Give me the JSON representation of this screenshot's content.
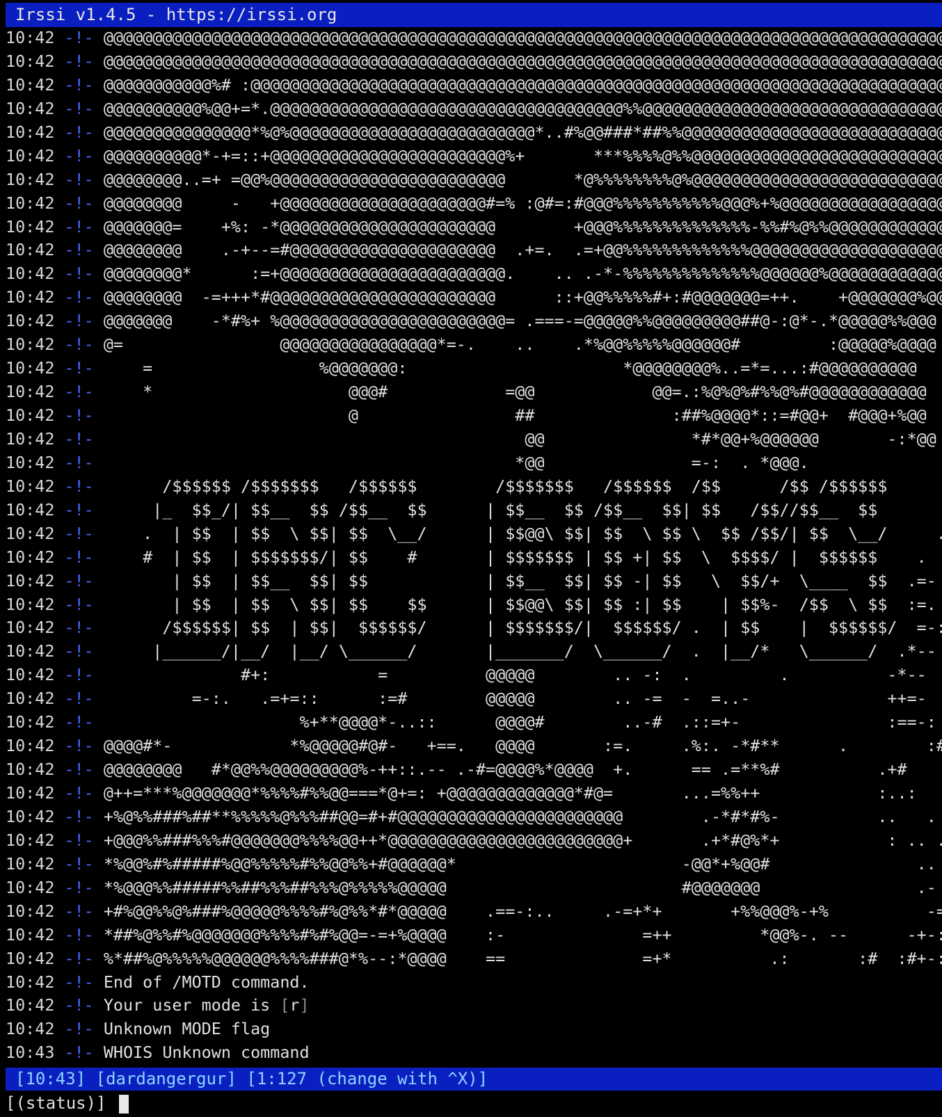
{
  "window": {
    "title": "Irssi v1.4.5 - https://irssi.org"
  },
  "colors": {
    "background": "#000000",
    "bar": "#0a1fc0",
    "separator": "#4a67ff",
    "bar_text": "#8fd4ff"
  },
  "messages": [
    {
      "time": "10:42",
      "text": "@@@@@@@@@@@@@@@@@@@@@@@@@@@@@@@@@@@@@@@@@@@@@@@@@@@@@@@@@@@@@@@@@@@@@@@@@@@@@@@@@@@@@@@@@@@@@@@@@@@@@"
    },
    {
      "time": "10:42",
      "text": "@@@@@@@@@@@@@@@@@@@@@@@@@@@@@@@@@@@@@@@@@@@@@@@@@@@@@@@@@@@@@@@@@@@@@@@@@@@@@@@@@@@@@@@@@@@@@@@@@@@@@"
    },
    {
      "time": "10:42",
      "text": "@@@@@@@@@@@%# :@@@@@@@@@@@@@@@@@@@@@@@@@@@@@@@@@@@@@@@@@@@@@@@@@@@@@@@@@@@@@@@@@@@@@@@@@@@@@@@@@"
    },
    {
      "time": "10:42",
      "text": "@@@@@@@@@@%@@+=*.@@@@@@@@@@@@@@@@@@@@@@@@@@@@@@@@@@@@%%@@@@@@@@@@@@@@@@@@@@@@@@@@@@@@@"
    },
    {
      "time": "10:42",
      "text": "@@@@@@@@@@@@@@@*%@%@@@@@@@@@@@@@@@@@@@@@@@@@*..#%@@###*##%%@@@@@@@@@@@@@@@@@@@@@@@@@@@@@"
    },
    {
      "time": "10:42",
      "text": "@@@@@@@@@@*-+=::+@@@@@@@@@@@@@@@@@@@@@@@@%+       ***%%%%@%%@@@@@@@@@@@@@@@@@@@@@@@@@@@@@"
    },
    {
      "time": "10:42",
      "text": "@@@@@@@@..=+ =@@%@@@@@@@@@@@@@@@@@@@@@@@@       *@%%%%%%%%@%@@@@@@@@@@@@@@@@@@@@@@@@@@@@"
    },
    {
      "time": "10:42",
      "text": "@@@@@@@@     -   +@@@@@@@@@@@@@@@@@@@@@#=% :@#=:#@@@%%%%%%%%%%%@@@%+%@@@@@@@@@@@@@@@@@@@@@"
    },
    {
      "time": "10:42",
      "text": "@@@@@@@=    +%: -*@@@@@@@@@@@@@@@@@@@@@@        +@@@%%%%%%%%%%%%%%-%%#%@%%@@@@@@@@@@@@"
    },
    {
      "time": "10:42",
      "text": "@@@@@@@@    .-+--=#@@@@@@@@@@@@@@@@@@@@@  .+=.  .=+@@%%%%%%%%%%%%%@@@@@@@@@@@@@@@@@@@@@@@"
    },
    {
      "time": "10:42",
      "text": "@@@@@@@@*      :=+@@@@@@@@@@@@@@@@@@@@@@@.    .. .-*-%%%%%%%%%%%%%%@@@@@@%@@@@@@@@@@@@@@@@@"
    },
    {
      "time": "10:42",
      "text": "@@@@@@@@  -=+++*#@@@@@@@@@@@@@@@@@@@@@@@      ::+@@%%%%%#+:#@@@@@@@=++.    +@@@@@@@%@@@"
    },
    {
      "time": "10:42",
      "text": "@@@@@@@    -*#%+ %@@@@@@@@@@@@@@@@@@@@@@@= .===-=@@@@@%%@@@@@@@@@##@-:@*-.*@@@@@%%@@@"
    },
    {
      "time": "10:42",
      "text": "@=                @@@@@@@@@@@@@@@@*=-.    ..    .*%@@%%%%%@@@@@@#         :@@@@@%@@@@"
    },
    {
      "time": "10:42",
      "text": "    =                 %@@@@@@@:                      *@@@@@@@@%..=*=...:#@@@@@@@@@@"
    },
    {
      "time": "10:42",
      "text": "    *                    @@@#            =@@            @@=.:%@%@%#%%@%#@@@@@@@@@@@@"
    },
    {
      "time": "10:42",
      "text": "                         @                ##              :##%@@@@*::=#@@+  #@@@+%@@"
    },
    {
      "time": "10:42",
      "text": "                                           @@               *#*@@+%@@@@@@       -:*@@"
    },
    {
      "time": "10:42",
      "text": "                                          *@@               =-:  . *@@@."
    },
    {
      "time": "10:42",
      "text": "      /$$$$$$ /$$$$$$$   /$$$$$$        /$$$$$$$   /$$$$$$  /$$      /$$ /$$$$$$"
    },
    {
      "time": "10:42",
      "text": "     |_  $$_/| $$__  $$ /$$__  $$      | $$__  $$ /$$__  $$| $$   /$$//$$__  $$"
    },
    {
      "time": "10:42",
      "text": "    .  | $$  | $$  \\ $$| $$  \\__/      | $$@@\\ $$| $$  \\ $$ \\  $$ /$$/| $$  \\__/     ."
    },
    {
      "time": "10:42",
      "text": "    #  | $$  | $$$$$$$/| $$    #       | $$$$$$$ | $$ +| $$  \\  $$$$/ |  $$$$$$    ."
    },
    {
      "time": "10:42",
      "text": "       | $$  | $$__  $$| $$            | $$__  $$| $$ -| $$   \\  $$/+  \\____  $$  .=-"
    },
    {
      "time": "10:42",
      "text": "       | $$  | $$  \\ $$| $$    $$      | $$@@\\ $$| $$ :| $$    | $$%-  /$$  \\ $$  :=."
    },
    {
      "time": "10:42",
      "text": "      /$$$$$$| $$  | $$|  $$$$$$/      | $$$$$$$/|  $$$$$$/ .  | $$    |  $$$$$$/  =-:"
    },
    {
      "time": "10:42",
      "text": "     |______/|__/  |__/ \\______/       |_______/  \\______/  .  |__/*   \\______/  .*--"
    },
    {
      "time": "10:42",
      "text": "              #+:           =          @@@@@        .. -:  .         .          -*--"
    },
    {
      "time": "10:42",
      "text": "         =-:.   .=+=::      :=#        @@@@@        .. -=  -  =..-              ++=-"
    },
    {
      "time": "10:42",
      "text": "                    %+**@@@@*-..::      @@@@#        ..-#  .::=+-               :==-:"
    },
    {
      "time": "10:42",
      "text": "@@@@#*-            *%@@@@@#@#-   +==.   @@@@       :=.     .%:. -*#**      .        :#@++"
    },
    {
      "time": "10:42",
      "text": "@@@@@@@@   #*@@%%@@@@@@@@@%-++::.-- .-#=@@@@%*@@@@  +.      == .=**%#          .+#"
    },
    {
      "time": "10:42",
      "text": "@++=***%@@@@@@@*%%%%#%%@@===*@+=: +@@@@@@@@@@@@@*#@=       ...=%%++            :..:"
    },
    {
      "time": "10:42",
      "text": "+%@%%###%##**%%%%%@%%%##@@=#+#@@@@@@@@@@@@@@@@@@@@@@@        .-*#*#%-          ..   ."
    },
    {
      "time": "10:42",
      "text": "+@@@%%###%%%#@@@@@@@%%%%@@++*@@@@@@@@@@@@@@@@@@@@@@@@+       .+*#@%*+           : .. ."
    },
    {
      "time": "10:42",
      "text": "*%@@%#%#####%@@%%%%%#%%@@%%+#@@@@@@*                       -@@*+%@@#               .."
    },
    {
      "time": "10:42",
      "text": "*%@@@%%#####%%##%%%##%%%@%%%%%@@@@@                        #@@@@@@@                .-"
    },
    {
      "time": "10:42",
      "text": "+#%@@%%@%###%@@@@@%%%%#%@%%*#*@@@@@    .==-:..     .-=+*+       +%%@@@%-+%          -==="
    },
    {
      "time": "10:42",
      "text": "*##%@%%#%@@@@@@@%%%%#%#%@@=-=+%@@@@    :-              =++         *@@%-. --      -+-:."
    },
    {
      "time": "10:42",
      "text": "%*##%@%%%%%@@@@@@%%%%###@*%--:*@@@@    ==              =+*          .:       :#  :#+-:::"
    },
    {
      "time": "10:42",
      "text": "End of /MOTD command."
    },
    {
      "time": "10:42",
      "text": "Your user mode is ",
      "mode": "r"
    },
    {
      "time": "10:42",
      "text": "Unknown MODE flag"
    },
    {
      "time": "10:43",
      "text": "WHOIS Unknown command"
    }
  ],
  "statusbar": {
    "time": "10:43",
    "nick": "dardangergur",
    "window": "1:127 (change with ^X)"
  },
  "input": {
    "prompt": "[(status)]",
    "value": ""
  }
}
